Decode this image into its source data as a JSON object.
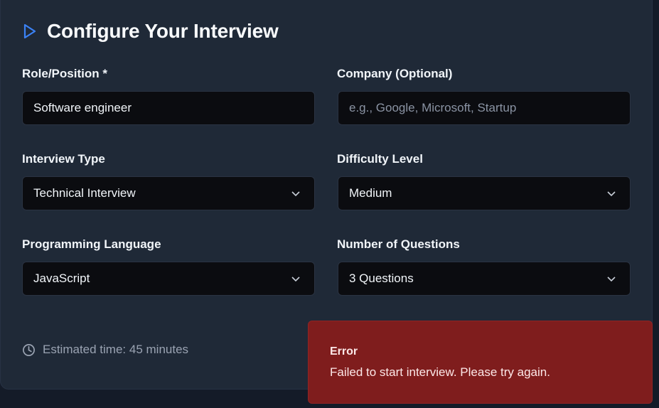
{
  "header": {
    "title": "Configure Your Interview",
    "icon": "play-outline-icon",
    "accent": "#3b82f6"
  },
  "form": {
    "role": {
      "label": "Role/Position *",
      "value": "Software engineer"
    },
    "company": {
      "label": "Company (Optional)",
      "placeholder": "e.g., Google, Microsoft, Startup",
      "value": ""
    },
    "interview_type": {
      "label": "Interview Type",
      "value": "Technical Interview"
    },
    "difficulty": {
      "label": "Difficulty Level",
      "value": "Medium"
    },
    "language": {
      "label": "Programming Language",
      "value": "JavaScript"
    },
    "questions": {
      "label": "Number of Questions",
      "value": "3 Questions"
    }
  },
  "footer": {
    "estimated": "Estimated time: 45 minutes",
    "icon": "clock-icon"
  },
  "toast": {
    "title": "Error",
    "message": "Failed to start interview. Please try again.",
    "color": "#7f1d1d"
  }
}
